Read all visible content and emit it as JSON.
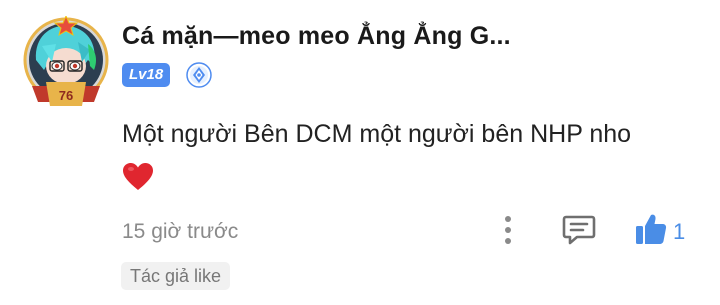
{
  "comment": {
    "username": "Cá mặn—meo meo Ẳng Ẳng G...",
    "level": "Lv18",
    "avatar_badge_number": "76",
    "content": "Một người Bên DCM một người bên NHP nho",
    "emoji": "❤️",
    "timestamp": "15 giờ trước",
    "like_count": "1",
    "author_like_label": "Tác giả like"
  },
  "colors": {
    "level_badge": "#4f8cf0",
    "like_accent": "#4a8de6",
    "heart": "#e0262f",
    "meta_text": "#8a8a8a"
  },
  "icons": {
    "verify": "shield-check-icon",
    "more": "more-vertical-icon",
    "reply": "comment-icon",
    "like": "thumbs-up-icon"
  }
}
